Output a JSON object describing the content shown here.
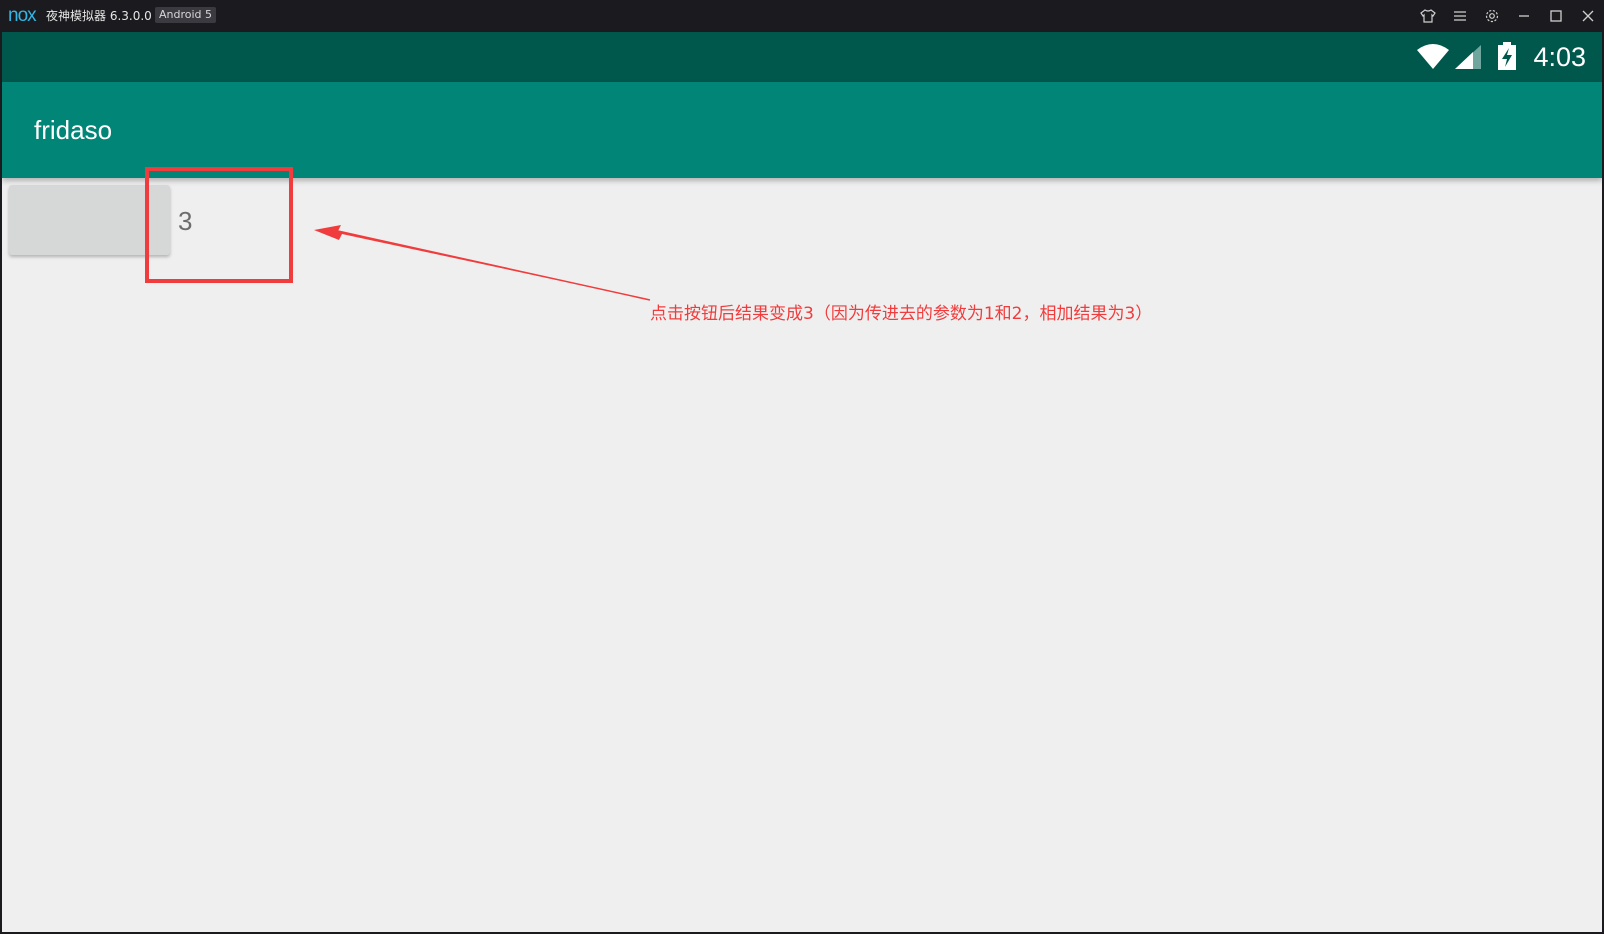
{
  "emulator": {
    "logo": "nox",
    "title": "夜神模拟器 6.3.0.0",
    "badge": "Android 5",
    "window_icons": [
      "shirt-icon",
      "menu-icon",
      "gear-icon",
      "minimize-icon",
      "maximize-icon",
      "close-icon"
    ]
  },
  "status_bar": {
    "time": "4:03",
    "icons": [
      "wifi-icon",
      "signal-icon",
      "battery-charging-icon"
    ],
    "background": "#00574b"
  },
  "app": {
    "title": "fridaso",
    "toolbar_color": "#008577",
    "button_label": "",
    "result_value": "3"
  },
  "annotation": {
    "text": "点击按钮后结果变成3（因为传进去的参数为1和2，相加结果为3）",
    "color": "#f03c3c"
  }
}
